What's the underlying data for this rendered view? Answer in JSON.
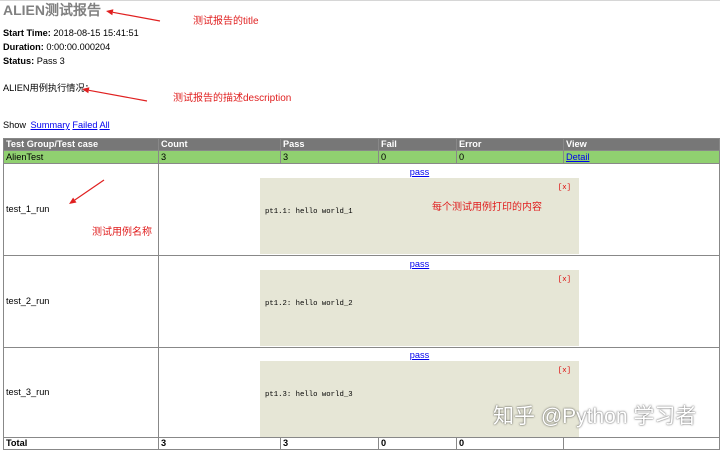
{
  "report": {
    "title": "ALIEN测试报告",
    "attributes": [
      {
        "label": "Start Time:",
        "value": "2018-08-15 15:41:51"
      },
      {
        "label": "Duration:",
        "value": "0:00:00.000204"
      },
      {
        "label": "Status:",
        "value": "Pass 3"
      }
    ],
    "description": "ALIEN用例执行情况："
  },
  "filter": {
    "label": "Show",
    "links": [
      "Summary",
      "Failed",
      "All"
    ]
  },
  "table": {
    "headers": [
      "Test Group/Test case",
      "Count",
      "Pass",
      "Fail",
      "Error",
      "View"
    ],
    "group": {
      "name": "AlienTest",
      "count": 3,
      "pass": 3,
      "fail": 0,
      "error": 0,
      "view": "Detail"
    },
    "cases": [
      {
        "name": "test_1_run",
        "result": "pass",
        "close": "[x]",
        "output": "pt1.1: hello world_1"
      },
      {
        "name": "test_2_run",
        "result": "pass",
        "close": "[x]",
        "output": "pt1.2: hello world_2"
      },
      {
        "name": "test_3_run",
        "result": "pass",
        "close": "[x]",
        "output": "pt1.3: hello world_3"
      }
    ],
    "total": {
      "label": "Total",
      "count": 3,
      "pass": 3,
      "fail": 0,
      "error": 0
    }
  },
  "annotations": {
    "title_note": "测试报告的title",
    "description_note": "测试报告的描述description",
    "case_name_note": "测试用例名称",
    "output_note": "每个测试用例打印的内容"
  },
  "watermark": {
    "text": "知乎 @Python 学习者"
  },
  "colors": {
    "title": "#808080",
    "link": "#0000ee",
    "header_bg": "#777777",
    "pass_group_bg": "#90d070",
    "popup_bg": "#e6e6d6",
    "close": "#dd0000",
    "annotation": "#e02020",
    "border": "#888888"
  }
}
